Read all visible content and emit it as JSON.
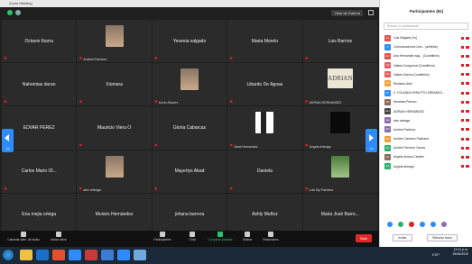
{
  "window": {
    "title": "Zoom Meeting"
  },
  "topbar": {
    "view_label": "Vista de Galería"
  },
  "participants_tiles": [
    {
      "name": "Octavio Ibarra",
      "label": "",
      "photo": ""
    },
    {
      "name": "",
      "label": "Andrea Pacheco",
      "photo": "person"
    },
    {
      "name": "Yesenia salgado",
      "label": "",
      "photo": ""
    },
    {
      "name": "Maria Morelo",
      "label": "",
      "photo": ""
    },
    {
      "name": "Luis Barrios",
      "label": "",
      "photo": ""
    },
    {
      "name": "Nahomias duran",
      "label": "",
      "photo": ""
    },
    {
      "name": "Xiomara",
      "label": "",
      "photo": ""
    },
    {
      "name": "",
      "label": "Kevin Álvarez",
      "photo": "person"
    },
    {
      "name": "Libardo De Agoas",
      "label": "",
      "photo": ""
    },
    {
      "name": "",
      "label": "ADRIAN HERNANDEZ",
      "photo": "adrian"
    },
    {
      "name": "EDVAR PEREZ",
      "label": "",
      "photo": ""
    },
    {
      "name": "Mauricio Viera O",
      "label": "",
      "photo": ""
    },
    {
      "name": "Gloria Cabarcas",
      "label": "",
      "photo": ""
    },
    {
      "name": "",
      "label": "Sarai Hernandez",
      "photo": "flag"
    },
    {
      "name": "",
      "label": "Angela Arteaga",
      "photo": "dark"
    },
    {
      "name": "Carlos Mario Ol...",
      "label": "",
      "photo": ""
    },
    {
      "name": "",
      "label": "alex arteaga",
      "photo": "person"
    },
    {
      "name": "Mayerlys Abad",
      "label": "",
      "photo": ""
    },
    {
      "name": "Daniela",
      "label": "",
      "photo": ""
    },
    {
      "name": "",
      "label": "Luis My Pacheco",
      "photo": "green"
    },
    {
      "name": "Ena mejia ortega",
      "label": "",
      "photo": ""
    },
    {
      "name": "Moisés Hernández",
      "label": "",
      "photo": ""
    },
    {
      "name": "johana barrera",
      "label": "",
      "photo": ""
    },
    {
      "name": "Ashly Muñoz",
      "label": "",
      "photo": ""
    },
    {
      "name": "Maria José Barre...",
      "label": "",
      "photo": ""
    }
  ],
  "paging": {
    "left_page": "1/4",
    "right_page": "1/4"
  },
  "toolbar": {
    "mute": "Cancelar silen. de áudio",
    "video": "Iniciar vídeo",
    "participants": "Participantes",
    "participants_count": "81",
    "chat": "Chat",
    "share": "Compartir pantalla",
    "record": "Grabar",
    "reactions": "Reacciones",
    "leave": "Salir"
  },
  "panel": {
    "title": "Participantes (81)",
    "search_placeholder": "Buscar un participante",
    "participants": [
      {
        "name": "Lina Salgado (Yo)",
        "color": "#d9534f",
        "initials": "LS"
      },
      {
        "name": "Comunicaciones Univ... (anfitrión)",
        "color": "#2d8cff",
        "initials": "C"
      },
      {
        "name": "Ana Hernández sag... (Coanfitrión)",
        "color": "#d9534f",
        "initials": "AH"
      },
      {
        "name": "Valeria Zorrgoncal (Coanfitrión)",
        "color": "#e4605e",
        "initials": "VZ"
      },
      {
        "name": "Valeria Garcia (Coanfitrión)",
        "color": "#e4605e",
        "initials": "VG"
      },
      {
        "name": "Richardo Ariel",
        "color": "#f0a03c",
        "initials": "RA"
      },
      {
        "name": "Z. YOLANDA VERA PTO URBANDO...",
        "color": "#2d8cff",
        "initials": "ZY"
      },
      {
        "name": "Abraham Palomo",
        "color": "#8a6a5a",
        "initials": "AP"
      },
      {
        "name": "ADRIAN HERNÁNDEZ",
        "color": "#444",
        "initials": "AH"
      },
      {
        "name": "alex arteaga",
        "color": "#8c6fb0",
        "initials": "aa"
      },
      {
        "name": "Andrea Pacheco",
        "color": "#8c6fb0",
        "initials": "AP"
      },
      {
        "name": "Andrés Cárcamo Pastrana",
        "color": "#f0a03c",
        "initials": "AC"
      },
      {
        "name": "Andrés Pacheco Osuda",
        "color": "#29b36a",
        "initials": "AP"
      },
      {
        "name": "Ángela Aevara Cardeni",
        "color": "#8a6a5a",
        "initials": "AA"
      },
      {
        "name": "Angela Arteaga",
        "color": "#29b36a",
        "initials": "AA"
      }
    ],
    "invite": "Invitar",
    "mute_all": "Silenciar todos"
  },
  "taskbar": {
    "time": "12:41 p.m.",
    "date": "25/06/2020",
    "lang": "ESP"
  }
}
